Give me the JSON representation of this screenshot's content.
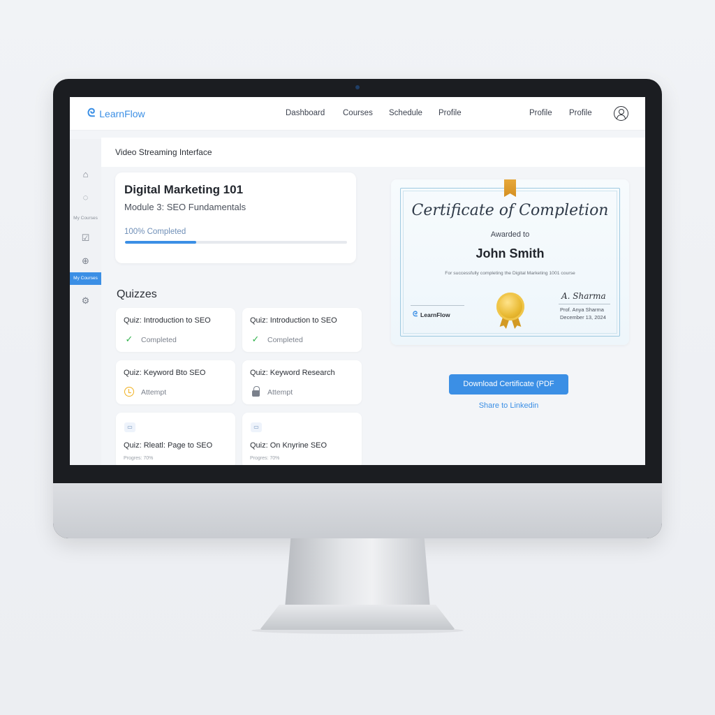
{
  "app": {
    "name": "LearnFlow"
  },
  "nav": {
    "items": [
      "Dashboard",
      "Courses",
      "Schedule",
      "Profile"
    ],
    "right_items": [
      "Profile",
      "Profile"
    ]
  },
  "sidebar": {
    "icons": [
      "home-icon",
      "chat-icon",
      "calendar-check-icon",
      "plus-circle-icon",
      "gear-icon"
    ],
    "label_my_courses": "My Courses",
    "active_label": "My Courses"
  },
  "page": {
    "title": "Video Streaming Interface"
  },
  "course": {
    "title": "Digital Marketing 101",
    "module": "Module 3: SEO Fundamentals",
    "progress_text": "100% Completed",
    "progress_fraction": 0.32
  },
  "quizzes": {
    "title": "Quizzes",
    "items": [
      {
        "title": "Quiz: Introduction to SEO",
        "status": "Completed",
        "icon": "check-icon"
      },
      {
        "title": "Quiz: Introduction to SEO",
        "status": "Completed",
        "icon": "check-icon"
      },
      {
        "title": "Quiz: Keyword Bto SEO",
        "status": "Attempt",
        "icon": "clock-icon"
      },
      {
        "title": "Quiz: Keyword Research",
        "status": "Attempt",
        "icon": "lock-icon"
      },
      {
        "title": "Quiz: Rleatl: Page to SEO",
        "progress": "Progres: 70%",
        "icon": "doc-icon"
      },
      {
        "title": "Quiz: On Knyrine SEO",
        "progress": "Progres: 70%",
        "icon": "doc-icon"
      }
    ]
  },
  "certificate": {
    "title": "Certificate of Completion",
    "awarded_to": "Awarded to",
    "recipient": "John Smith",
    "description": "For successfully completing the Digital Marketing 1001 course",
    "brand": "LearnFlow",
    "signer": "Prof. Anya Sharma",
    "date": "December 13, 2024",
    "signature_text": "A. Sharma"
  },
  "actions": {
    "download_label": "Download Certificate (PDF",
    "share_label": "Share to Linkedin"
  },
  "colors": {
    "accent": "#3b8fe5",
    "success": "#2fb24a",
    "warning": "#f0b020",
    "gold": "#e8b830"
  }
}
